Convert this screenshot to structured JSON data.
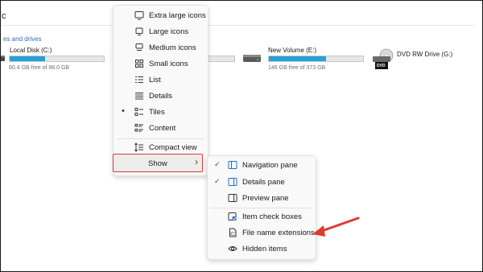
{
  "address": {
    "text": "c"
  },
  "group_header": "es and drives",
  "drives": [
    {
      "name": "Local Disk (C:)",
      "free_text": "60.4 GB free of 98.0 GB",
      "used_fraction": 0.38
    },
    {
      "name": "New Volume (E:)",
      "free_text": "146 GB free of 373 GB",
      "used_fraction": 0.61
    },
    {
      "name": "DVD RW Drive (G:)",
      "badge": "DVD"
    }
  ],
  "view_menu": {
    "items": [
      {
        "label": "Extra large icons",
        "icon": "monitor-icon"
      },
      {
        "label": "Large icons",
        "icon": "monitor-small-icon"
      },
      {
        "label": "Medium icons",
        "icon": "grid-medium-icon"
      },
      {
        "label": "Small icons",
        "icon": "grid-small-icon"
      },
      {
        "label": "List",
        "icon": "list-icon"
      },
      {
        "label": "Details",
        "icon": "details-icon"
      },
      {
        "label": "Tiles",
        "icon": "tiles-icon",
        "selected_mark": "•"
      },
      {
        "label": "Content",
        "icon": "content-icon"
      },
      {
        "label": "Compact view",
        "icon": "compact-icon"
      },
      {
        "label": "Show",
        "chevron": "›",
        "icon": "chevron-right-icon"
      }
    ]
  },
  "show_submenu": {
    "items": [
      {
        "label": "Navigation pane",
        "check": "✓"
      },
      {
        "label": "Details pane",
        "check": "✓"
      },
      {
        "label": "Preview pane",
        "check": ""
      },
      {
        "label": "Item check boxes",
        "check": ""
      },
      {
        "label": "File name extensions",
        "check": ""
      },
      {
        "label": "Hidden items",
        "check": ""
      }
    ]
  },
  "colors": {
    "annotation": "#e03a2e",
    "accent": "#26a0da",
    "link": "#2b6bbf"
  }
}
